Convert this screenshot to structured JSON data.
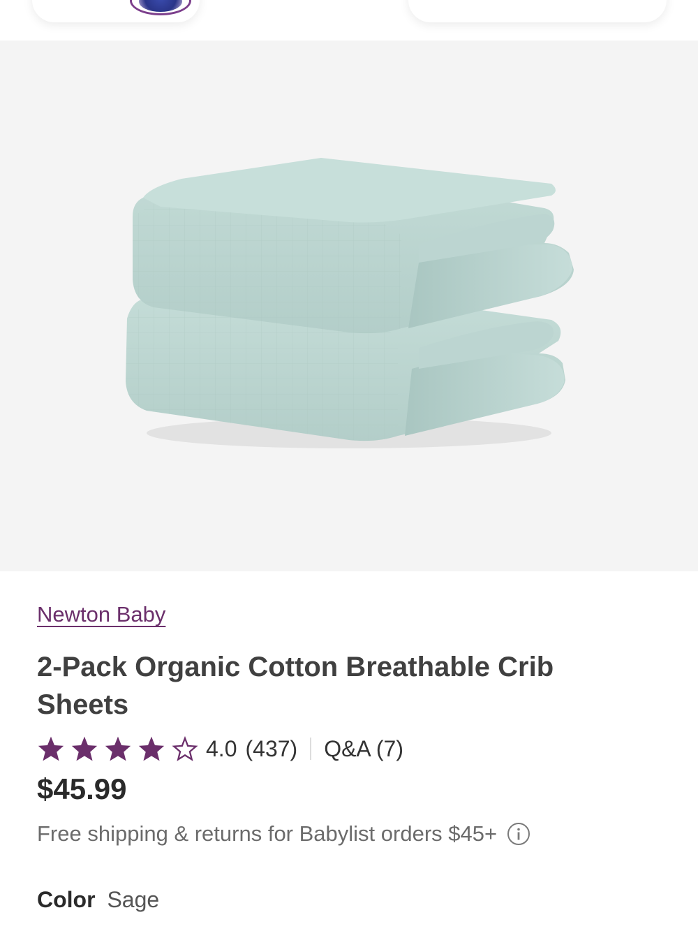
{
  "header": {
    "logo_icon": "babylist-logo-icon",
    "right_icons": [
      "search-icon",
      "registry-icon",
      "cart-icon"
    ]
  },
  "product": {
    "image_icon": "crib-sheets-product-image",
    "brand": "Newton Baby",
    "title": "2-Pack Organic Cotton Breathable Crib Sheets",
    "rating_value": "4.0",
    "rating_stars": 4,
    "rating_max": 5,
    "rating_count": "(437)",
    "qa": "Q&A (7)",
    "price": "$45.99",
    "shipping": "Free shipping & returns for Babylist orders $45+",
    "color_label": "Color",
    "color_value": "Sage"
  },
  "colors": {
    "brand_purple": "#6b2f6b",
    "star_fill": "#6b2f6b",
    "sheet_sage": "#b9d4cf"
  }
}
